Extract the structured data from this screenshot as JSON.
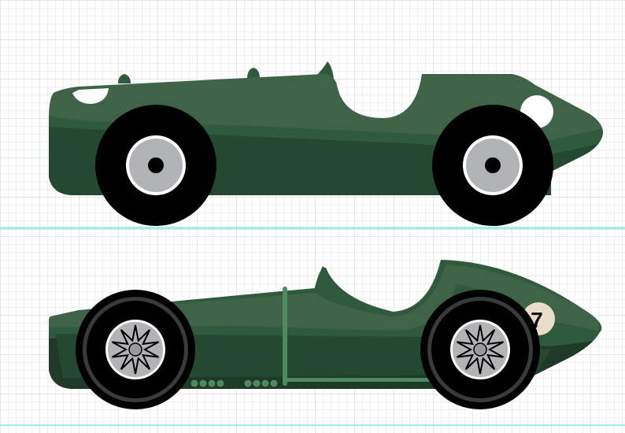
{
  "colors": {
    "canvas_bg": "#ffffff",
    "grid_minor": "#e3e3e3",
    "grid_major": "#cfcfcf",
    "guide_line": "#7eeaea",
    "body_dark_green": "#234a31",
    "body_mid_green": "#2f5a3e",
    "body_light_green": "#3e6347",
    "trim_green": "#4f8a5c",
    "tire_black": "#000000",
    "tire_grey": "#3a3a3a",
    "hub_grey": "#b2b3b7",
    "hub_white": "#ffffff",
    "number_disc": "#e9dccb"
  },
  "cars": [
    {
      "name": "simplified-race-car",
      "wheel_style": "solid hub"
    },
    {
      "name": "detailed-race-car",
      "wheel_style": "spoked",
      "number": "7"
    }
  ]
}
